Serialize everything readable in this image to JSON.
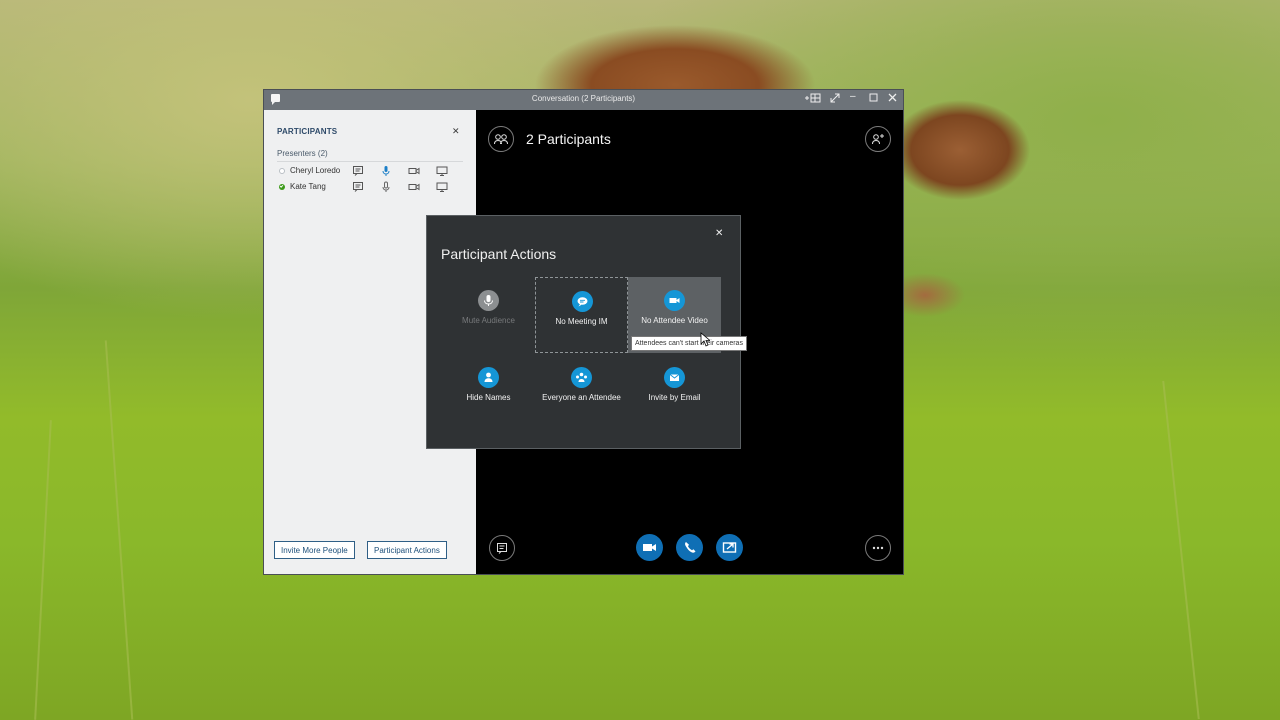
{
  "window": {
    "title": "Conversation (2 Participants)"
  },
  "left_panel": {
    "title": "PARTICIPANTS",
    "presenters_label": "Presenters (2)",
    "participants": [
      {
        "name": "Cheryl Loredo",
        "status": "offline"
      },
      {
        "name": "Kate Tang",
        "status": "online"
      }
    ],
    "invite_button": "Invite More People",
    "actions_button": "Participant Actions"
  },
  "stage": {
    "heading": "2 Participants"
  },
  "dialog": {
    "title": "Participant Actions",
    "actions": [
      {
        "label": "Mute Audience",
        "icon": "microphone-icon",
        "state": "disabled"
      },
      {
        "label": "No Meeting IM",
        "icon": "chat-bubble-icon",
        "state": "focused"
      },
      {
        "label": "No Attendee Video",
        "icon": "video-camera-icon",
        "state": "hover"
      },
      {
        "label": "Hide Names",
        "icon": "person-icon",
        "state": "normal"
      },
      {
        "label": "Everyone an Attendee",
        "icon": "group-icon",
        "state": "normal"
      },
      {
        "label": "Invite by Email",
        "icon": "email-icon",
        "state": "normal"
      }
    ],
    "tooltip": "Attendees can't start their cameras"
  },
  "colors": {
    "accent": "#1596d6",
    "call_button": "#0f6fb5",
    "titlebar": "#6d7379",
    "dialog_bg": "#2f3234",
    "panel_bg": "#eff0f1"
  }
}
